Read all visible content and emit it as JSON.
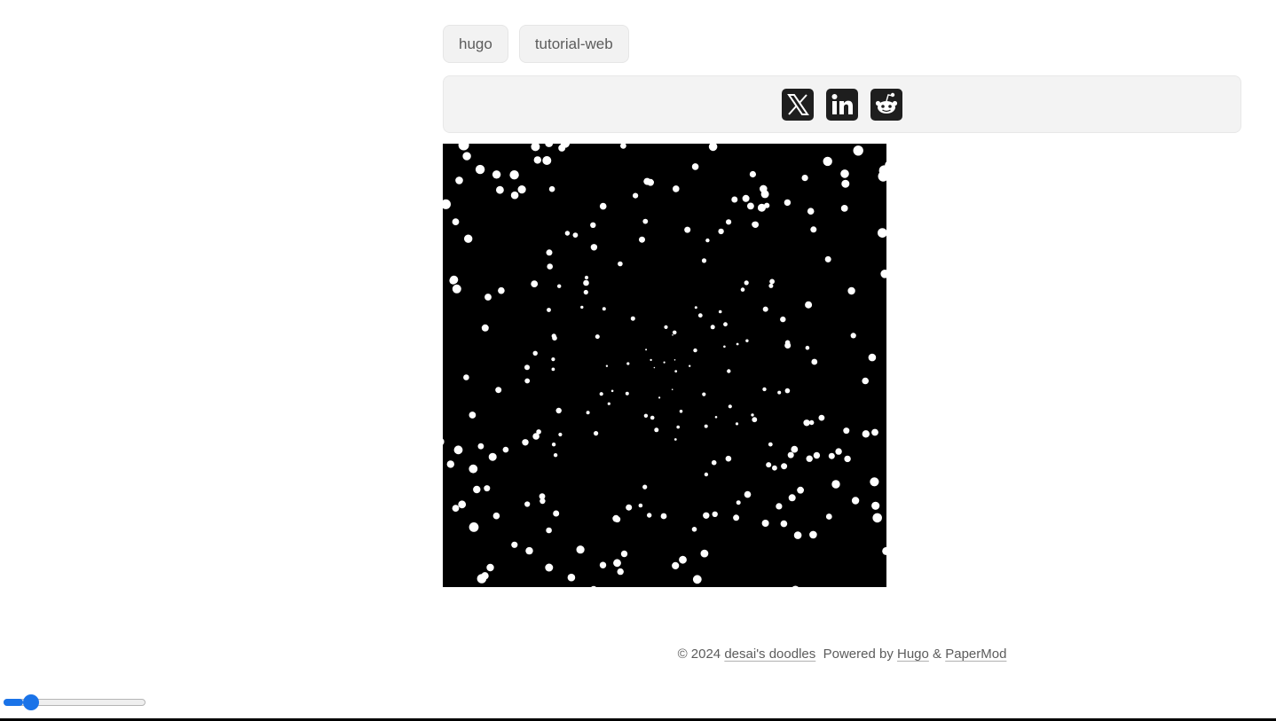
{
  "tags": [
    {
      "label": "hugo"
    },
    {
      "label": "tutorial-web"
    }
  ],
  "share": [
    {
      "name": "x-share-icon",
      "title": "share on x"
    },
    {
      "name": "linkedin-share-icon",
      "title": "share on linkedin"
    },
    {
      "name": "reddit-share-icon",
      "title": "share on reddit"
    }
  ],
  "footer": {
    "copyright": "© 2024",
    "site_name": "desai's doodles",
    "powered_by": "Powered by",
    "hugo": "Hugo",
    "amp": "&",
    "theme": "PaperMod"
  },
  "slider": {
    "value": 0.14
  },
  "colors": {
    "accent": "#1a73e8",
    "canvas_bg": "#000000",
    "dot": "#ffffff"
  }
}
